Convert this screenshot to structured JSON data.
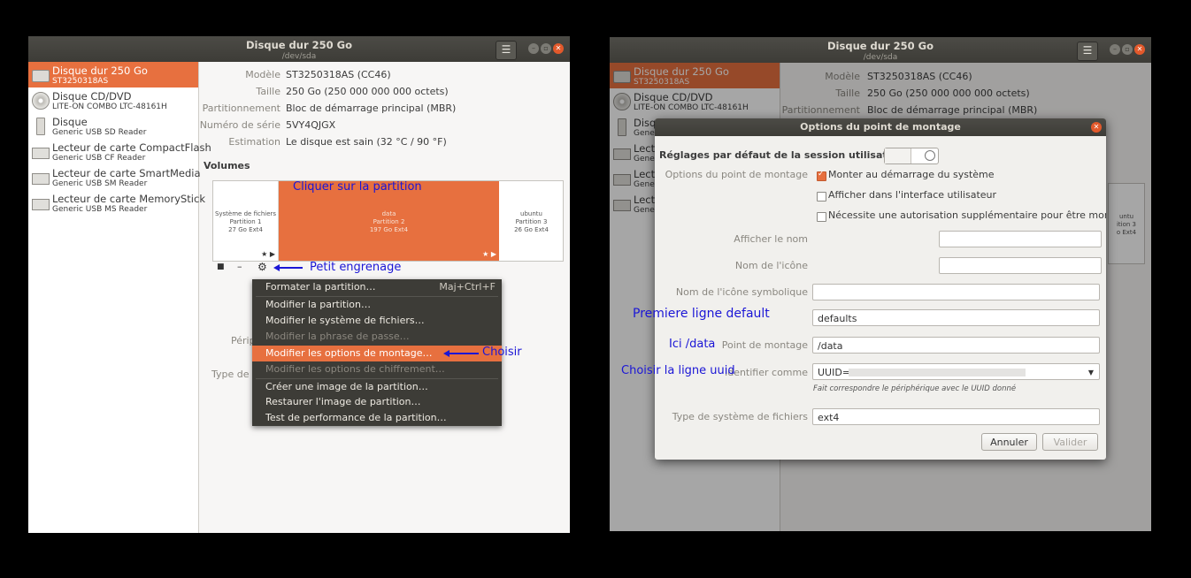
{
  "left_window": {
    "title": "Disque dur 250 Go",
    "subtitle": "/dev/sda",
    "menu_icon": "hamburger-icon",
    "drives": [
      {
        "name": "Disque dur 250 Go",
        "sub": "ST3250318AS",
        "icon": "hdd-icon"
      },
      {
        "name": "Disque CD/DVD",
        "sub": "LITE-ON COMBO LTC-48161H",
        "icon": "cd-icon"
      },
      {
        "name": "Disque",
        "sub": "Generic USB SD Reader",
        "icon": "usb-icon"
      },
      {
        "name": "Lecteur de carte CompactFlash",
        "sub": "Generic USB CF Reader",
        "icon": "card-reader-icon"
      },
      {
        "name": "Lecteur de carte SmartMedia",
        "sub": "Generic USB SM Reader",
        "icon": "card-reader-icon"
      },
      {
        "name": "Lecteur de carte MemoryStick",
        "sub": "Generic USB MS Reader",
        "icon": "card-reader-icon"
      }
    ],
    "props": [
      {
        "label": "Modèle",
        "value": "ST3250318AS (CC46)"
      },
      {
        "label": "Taille",
        "value": "250 Go (250 000 000 000 octets)"
      },
      {
        "label": "Partitionnement",
        "value": "Bloc de démarrage principal (MBR)"
      },
      {
        "label": "Numéro de série",
        "value": "5VY4QJGX"
      },
      {
        "label": "Estimation",
        "value": "Le disque est sain (32 °C / 90 °F)"
      }
    ],
    "volumes_title": "Volumes",
    "partitions": [
      {
        "l1": "Système de fichiers",
        "l2": "Partition 1",
        "l3": "27 Go Ext4"
      },
      {
        "l1": "data",
        "l2": "Partition 2",
        "l3": "197 Go Ext4"
      },
      {
        "l1": "ubuntu",
        "l2": "Partition 3",
        "l3": "26 Go Ext4"
      }
    ],
    "tools": {
      "stop": "■",
      "minus": "–"
    },
    "hidden_labels": [
      "Périp",
      "Type de p"
    ],
    "context_menu": [
      {
        "label": "Formater la partition…",
        "accel": "Maj+Ctrl+F"
      },
      {
        "label": "Modifier la partition…"
      },
      {
        "label": "Modifier le système de fichiers…"
      },
      {
        "label": "Modifier la phrase de passe…"
      },
      {
        "label": "Modifier les options de montage…"
      },
      {
        "label": "Modifier les options de chiffrement…"
      },
      {
        "label": "Créer une image de la partition…"
      },
      {
        "label": "Restaurer l'image de partition…"
      },
      {
        "label": "Test de performance de la partition…"
      }
    ],
    "annotations": {
      "click_partition": "Cliquer sur la partition",
      "gear": "Petit engrenage",
      "choose": "Choisir"
    }
  },
  "right_window": {
    "title": "Disque dur 250 Go",
    "subtitle": "/dev/sda",
    "drives": [
      {
        "name": "Disque dur 250 Go",
        "sub": "ST3250318AS"
      },
      {
        "name": "Disque CD/DVD",
        "sub": "LITE-ON COMBO LTC-48161H"
      },
      {
        "name": "Disq",
        "sub": "Gene"
      },
      {
        "name": "Lecte",
        "sub": "Gene"
      },
      {
        "name": "Lecte",
        "sub": "Gene"
      },
      {
        "name": "Lecte",
        "sub": "Gene"
      }
    ],
    "props": [
      {
        "label": "Modèle",
        "value": "ST3250318AS (CC46)"
      },
      {
        "label": "Taille",
        "value": "250 Go (250 000 000 000 octets)"
      },
      {
        "label": "Partitionnement",
        "value": "Bloc de démarrage principal (MBR)"
      }
    ],
    "partial_partition": {
      "l1": "untu",
      "l2": "ition 3",
      "l3": "o Ext4"
    },
    "dialog": {
      "title": "Options du point de montage",
      "session_label": "Réglages par défaut de la session utilisateur",
      "mount_options_label": "Options du point de montage",
      "checkboxes": [
        {
          "label": "Monter au démarrage du système",
          "checked": true
        },
        {
          "label": "Afficher dans l'interface utilisateur",
          "checked": false
        },
        {
          "label": "Nécessite une autorisation supplémentaire pour être monté",
          "checked": false
        }
      ],
      "fields": {
        "display_name_label": "Afficher le nom",
        "icon_name_label": "Nom de l'icône",
        "symbolic_icon_label": "Nom de l'icône symbolique",
        "options_value": "defaults",
        "mount_point_label": "Point de montage",
        "mount_point_value": "/data",
        "identify_label": "Identifier comme",
        "identify_value": "UUID=",
        "identify_hint": "Fait correspondre le périphérique avec le UUID donné",
        "fs_type_label": "Type de système de fichiers",
        "fs_type_value": "ext4"
      },
      "buttons": {
        "cancel": "Annuler",
        "ok": "Valider"
      }
    },
    "annotations": {
      "first_line": "Premiere ligne  default",
      "here_data": "Ici /data",
      "choose_uuid": "Choisir la ligne uuid"
    }
  },
  "colors": {
    "accent": "#e7703f",
    "titlebar": "#3d3c37",
    "annotation": "#1b16d6"
  }
}
